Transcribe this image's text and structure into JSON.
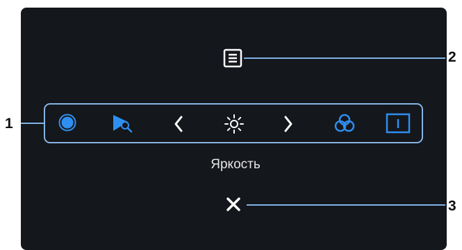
{
  "panel": {
    "menu_icon": "menu-icon",
    "close_icon": "close-icon",
    "current_label": "Яркость"
  },
  "iconbar": {
    "items": [
      {
        "icon": "preset-modes-icon",
        "color": "#2f8ff0"
      },
      {
        "icon": "input-source-icon",
        "color": "#2f8ff0"
      },
      {
        "icon": "chevron-left-icon",
        "color": "#ffffff"
      },
      {
        "icon": "brightness-icon",
        "color": "#ffffff"
      },
      {
        "icon": "chevron-right-icon",
        "color": "#ffffff"
      },
      {
        "icon": "color-icon",
        "color": "#2f8ff0"
      },
      {
        "icon": "info-icon",
        "color": "#2f8ff0"
      }
    ]
  },
  "callouts": [
    "1",
    "2",
    "3"
  ],
  "colors": {
    "panel_bg": "#14171c",
    "accent": "#2f8ff0",
    "outline": "#86b4e4",
    "text": "#e6e6e6"
  }
}
